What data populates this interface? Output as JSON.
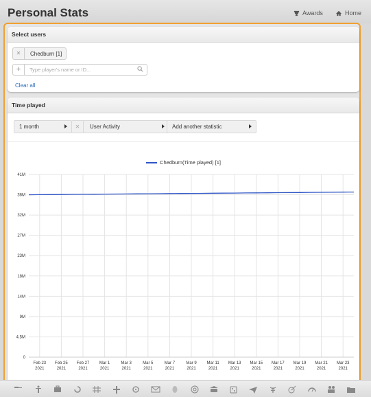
{
  "header": {
    "title": "Personal Stats",
    "awards_label": "Awards",
    "home_label": "Home"
  },
  "select_users": {
    "title": "Select users",
    "chip_label": "Chedburn [1]",
    "search_placeholder": "Type player's name or ID...",
    "clear_all": "Clear all"
  },
  "time_played": {
    "title": "Time played",
    "period_select": "1 month",
    "stat_select": "User Activity",
    "add_stat_select": "Add another statistic"
  },
  "chart_data": {
    "type": "line",
    "legend_entry": "Chedburn(Time played) [1]",
    "legend_placement": "top-center",
    "grid": true,
    "y_ticks": [
      "0",
      "4.5M",
      "9M",
      "14M",
      "18M",
      "23M",
      "27M",
      "32M",
      "36M",
      "41M"
    ],
    "y_tick_values": [
      0,
      4.5,
      9,
      13.5,
      18,
      22.5,
      27,
      31.5,
      36,
      40.5
    ],
    "ylim": [
      0,
      40.5
    ],
    "x_ticks": [
      [
        "Feb 23",
        "2021"
      ],
      [
        "Feb 25",
        "2021"
      ],
      [
        "Feb 27",
        "2021"
      ],
      [
        "Mar 1",
        "2021"
      ],
      [
        "Mar 3",
        "2021"
      ],
      [
        "Mar 5",
        "2021"
      ],
      [
        "Mar 7",
        "2021"
      ],
      [
        "Mar 9",
        "2021"
      ],
      [
        "Mar 11",
        "2021"
      ],
      [
        "Mar 13",
        "2021"
      ],
      [
        "Mar 15",
        "2021"
      ],
      [
        "Mar 17",
        "2021"
      ],
      [
        "Mar 19",
        "2021"
      ],
      [
        "Mar 21",
        "2021"
      ],
      [
        "Mar 23",
        "2021"
      ]
    ],
    "series": [
      {
        "name": "Chedburn(Time played) [1]",
        "color": "#2e55c6",
        "x": [
          "2021-02-22",
          "2021-02-23",
          "2021-02-24",
          "2021-02-25",
          "2021-02-26",
          "2021-02-27",
          "2021-02-28",
          "2021-03-01",
          "2021-03-02",
          "2021-03-03",
          "2021-03-04",
          "2021-03-05",
          "2021-03-06",
          "2021-03-07",
          "2021-03-08",
          "2021-03-09",
          "2021-03-10",
          "2021-03-11",
          "2021-03-12",
          "2021-03-13",
          "2021-03-14",
          "2021-03-15",
          "2021-03-16",
          "2021-03-17",
          "2021-03-18",
          "2021-03-19",
          "2021-03-20",
          "2021-03-21",
          "2021-03-22",
          "2021-03-23",
          "2021-03-24"
        ],
        "values": [
          36.0,
          36.02,
          36.04,
          36.06,
          36.08,
          36.1,
          36.12,
          36.14,
          36.16,
          36.18,
          36.2,
          36.22,
          36.24,
          36.26,
          36.28,
          36.3,
          36.32,
          36.34,
          36.36,
          36.38,
          36.4,
          36.42,
          36.44,
          36.46,
          36.48,
          36.5,
          36.52,
          36.54,
          36.56,
          36.58,
          36.6
        ]
      }
    ]
  },
  "bottom_toolbar": {
    "icons": [
      "hammer-icon",
      "man-icon",
      "briefcase-icon",
      "refresh-icon",
      "hash-icon",
      "cross-icon",
      "radiation-icon",
      "mail-icon",
      "egg-icon",
      "target-icon",
      "bank-icon",
      "dice-icon",
      "plane-icon",
      "leaf-icon",
      "dart-icon",
      "gauge-icon",
      "people-icon",
      "folder-icon"
    ]
  },
  "colors": {
    "accent_frame": "#f0a030",
    "series_line": "#2e55c6",
    "link": "#2a6ebb"
  }
}
